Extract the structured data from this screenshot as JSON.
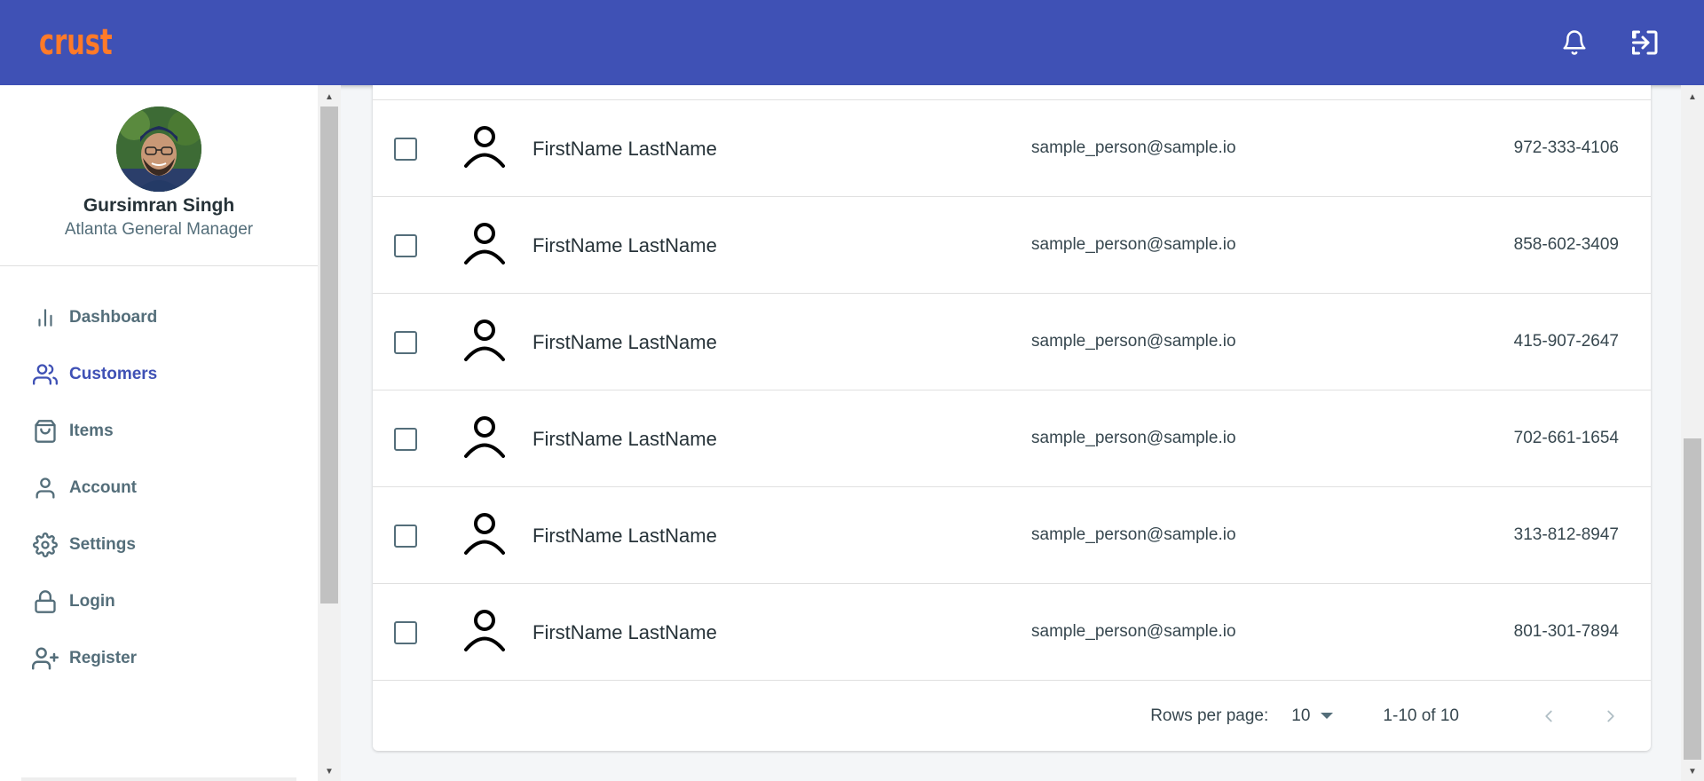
{
  "app": {
    "logo_text": "crust"
  },
  "topbar": {
    "notifications_icon": "bell-icon",
    "logout_icon": "logout-icon"
  },
  "profile": {
    "name": "Gursimran Singh",
    "title": "Atlanta General Manager"
  },
  "sidebar": {
    "items": [
      {
        "label": "Dashboard",
        "icon": "bar-chart-icon",
        "active": false
      },
      {
        "label": "Customers",
        "icon": "users-icon",
        "active": true
      },
      {
        "label": "Items",
        "icon": "shopping-bag-icon",
        "active": false
      },
      {
        "label": "Account",
        "icon": "user-icon",
        "active": false
      },
      {
        "label": "Settings",
        "icon": "gear-icon",
        "active": false
      },
      {
        "label": "Login",
        "icon": "lock-icon",
        "active": false
      },
      {
        "label": "Register",
        "icon": "user-plus-icon",
        "active": false
      }
    ]
  },
  "customers": {
    "rows": [
      {
        "name": "FirstName LastName",
        "email": "sample_person@sample.io",
        "phone": "972-333-4106"
      },
      {
        "name": "FirstName LastName",
        "email": "sample_person@sample.io",
        "phone": "858-602-3409"
      },
      {
        "name": "FirstName LastName",
        "email": "sample_person@sample.io",
        "phone": "415-907-2647"
      },
      {
        "name": "FirstName LastName",
        "email": "sample_person@sample.io",
        "phone": "702-661-1654"
      },
      {
        "name": "FirstName LastName",
        "email": "sample_person@sample.io",
        "phone": "313-812-8947"
      },
      {
        "name": "FirstName LastName",
        "email": "sample_person@sample.io",
        "phone": "801-301-7894"
      }
    ]
  },
  "pagination": {
    "rows_per_page_label": "Rows per page:",
    "rows_per_page": "10",
    "range": "1-10 of 10"
  },
  "colors": {
    "primary": "#3f51b5",
    "logo": "#ff7a29",
    "text": "#263238",
    "muted": "#546e7a"
  }
}
